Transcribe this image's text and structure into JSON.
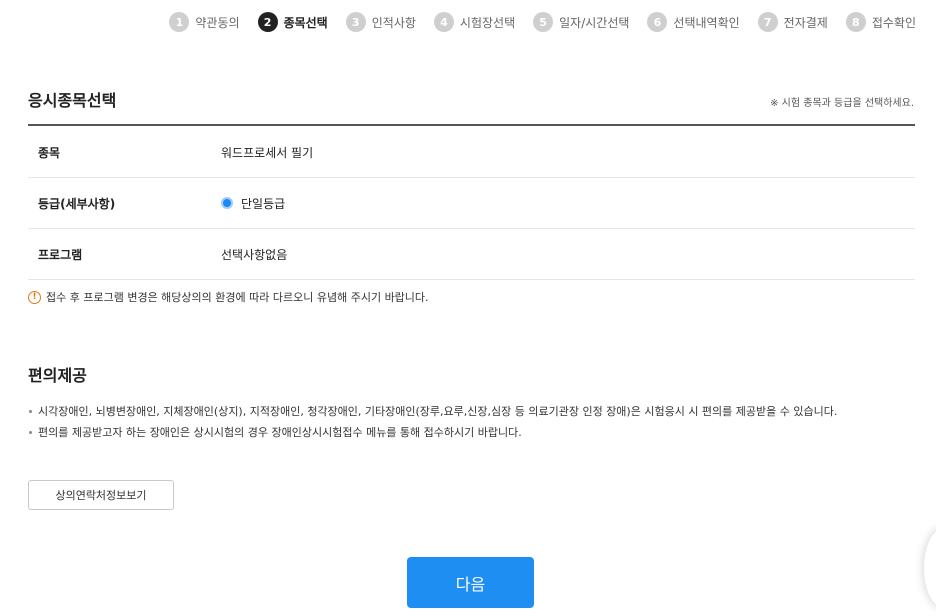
{
  "steps": [
    {
      "num": "1",
      "label": "약관동의"
    },
    {
      "num": "2",
      "label": "종목선택"
    },
    {
      "num": "3",
      "label": "인적사항"
    },
    {
      "num": "4",
      "label": "시험장선택"
    },
    {
      "num": "5",
      "label": "일자/시간선택"
    },
    {
      "num": "6",
      "label": "선택내역확인"
    },
    {
      "num": "7",
      "label": "전자결제"
    },
    {
      "num": "8",
      "label": "접수확인"
    }
  ],
  "active_step": "2",
  "section1": {
    "title": "응시종목선택",
    "note": "※ 시험 종목과 등급을 선택하세요.",
    "rows": [
      {
        "label": "종목",
        "value": "워드프로세서 필기"
      },
      {
        "label": "등급(세부사항)",
        "value": "단일등급"
      },
      {
        "label": "프로그램",
        "value": "선택사항없음"
      }
    ],
    "notice": "접수 후 프로그램 변경은 해당상의의 환경에 따라 다르오니 유념해 주시기 바랍니다."
  },
  "section2": {
    "title": "편의제공",
    "bullets": [
      "시각장애인, 뇌병변장애인, 지체장애인(상지), 지적장애인, 청각장애인, 기타장애인(장루,요루,신장,심장 등 의료기관장 인정 장애)은 시험응시 시 편의를 제공받을 수 있습니다.",
      "편의를 제공받고자 하는 장애인은 상시시험의 경우 장애인상시시험접수 메뉴를 통해 접수하시기 바랍니다."
    ],
    "contact_button": "상의연락처정보보기"
  },
  "next_button": "다음",
  "colors": {
    "accent": "#1e8ef2",
    "notice_icon": "#e07a18",
    "active_step": "#222222",
    "inactive_step": "#cfcfcf"
  }
}
